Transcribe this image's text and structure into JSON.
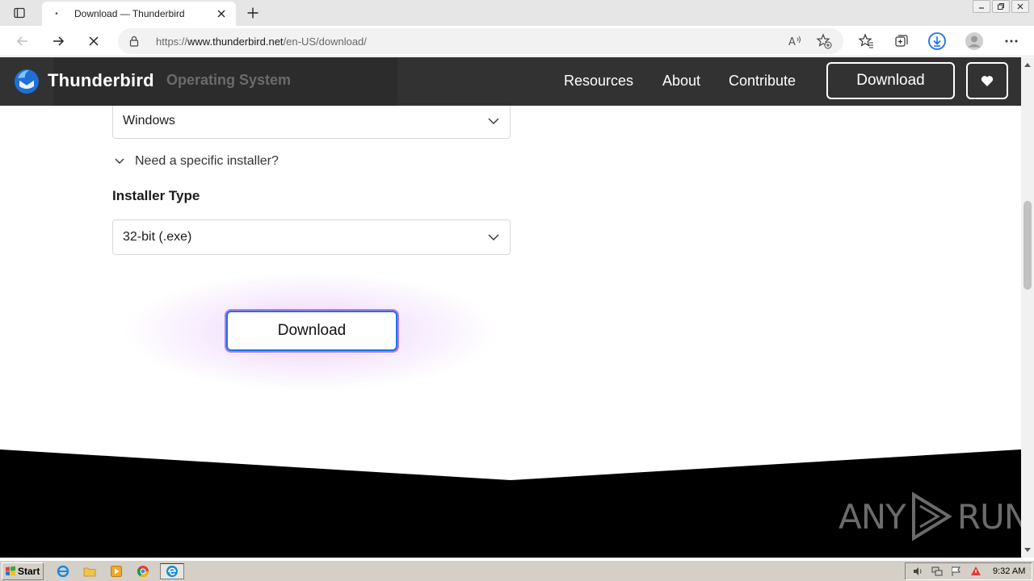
{
  "browser": {
    "tab_title": "Download — Thunderbird",
    "url_prefix": "https://",
    "url_domain": "www.thunderbird.net",
    "url_path": "/en-US/download/"
  },
  "site": {
    "brand": "Thunderbird",
    "nav": [
      {
        "label": "Resources"
      },
      {
        "label": "About"
      },
      {
        "label": "Contribute"
      }
    ],
    "header_download": "Download",
    "behind_header_label": "Operating System"
  },
  "form": {
    "os_value": "Windows",
    "specific_installer_toggle": "Need a specific installer?",
    "installer_type_label": "Installer Type",
    "installer_value": "32-bit (.exe)",
    "download_label": "Download"
  },
  "watermark": {
    "left": "ANY",
    "right": "RUN"
  },
  "taskbar": {
    "start_label": "Start",
    "clock": "9:32 AM"
  },
  "colors": {
    "header_bg": "#141414",
    "accent_blue": "#1a73e8",
    "glow_purple": "#b27be8",
    "footer_bg": "#000000"
  }
}
